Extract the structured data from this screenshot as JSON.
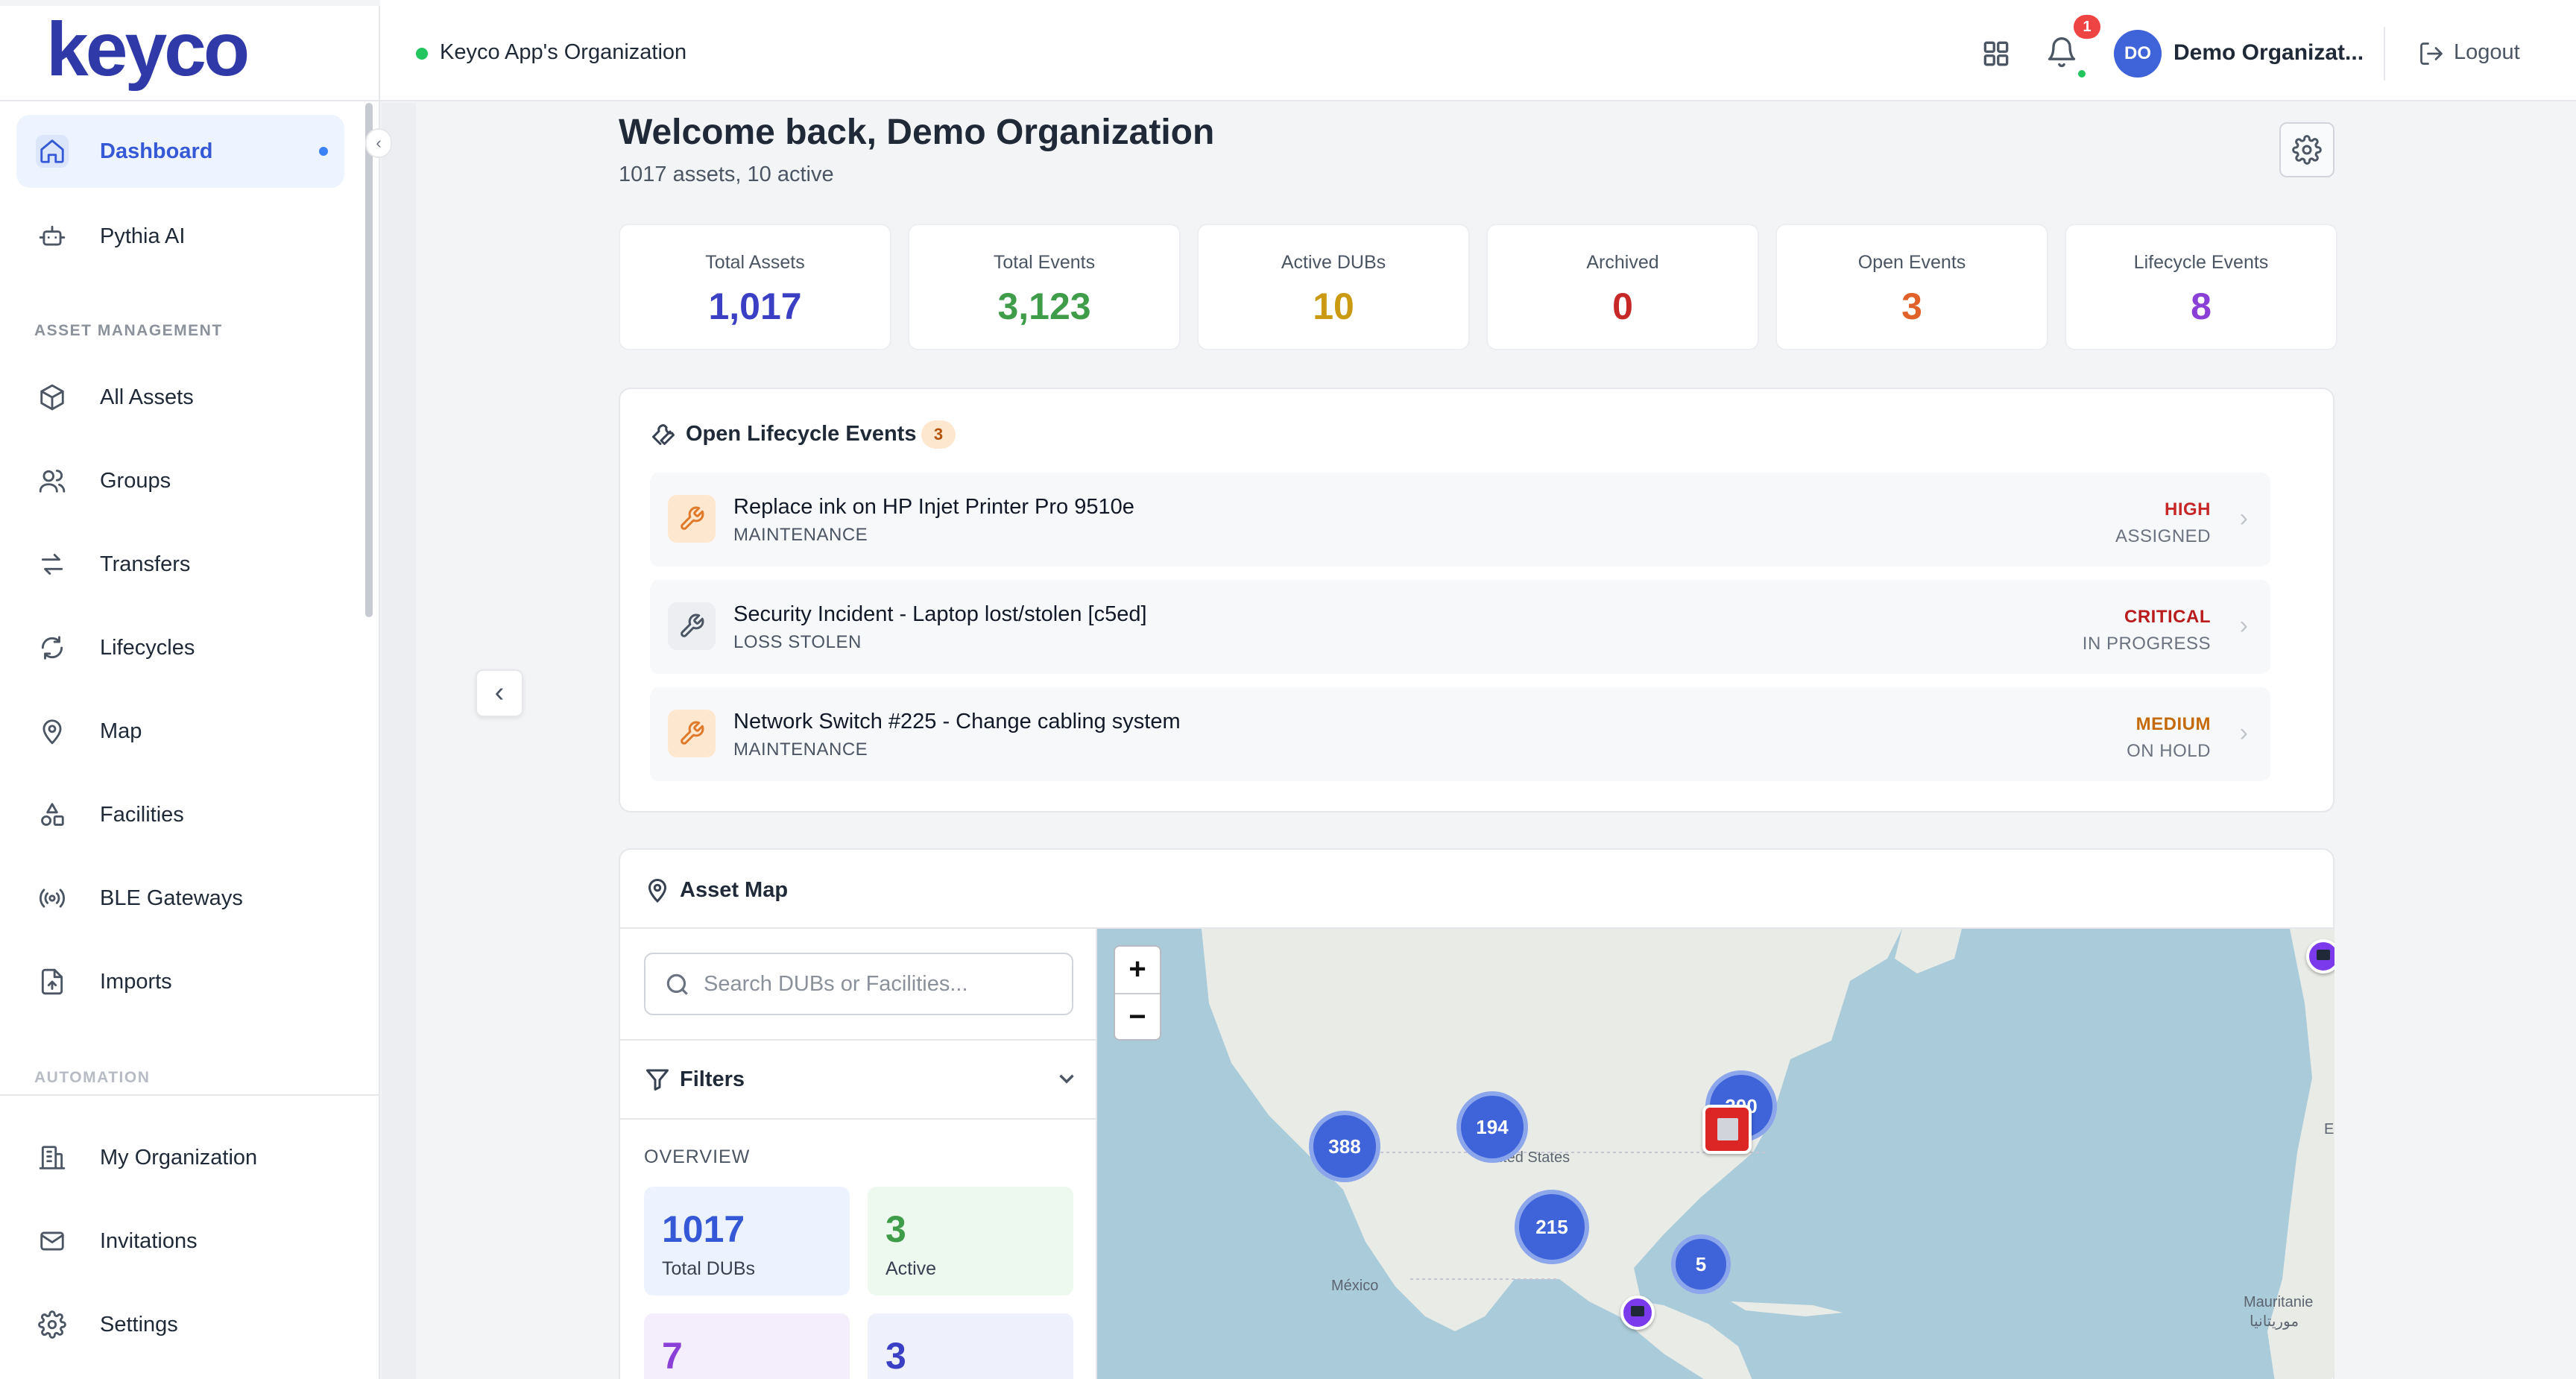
{
  "app": {
    "brand": "keyco"
  },
  "sidebar": {
    "top_items": [
      {
        "label": "Dashboard",
        "icon": "home-icon",
        "active": true
      },
      {
        "label": "Pythia AI",
        "icon": "robot-icon"
      }
    ],
    "sections": [
      {
        "label": "ASSET MANAGEMENT",
        "items": [
          {
            "label": "All Assets",
            "icon": "box-icon"
          },
          {
            "label": "Groups",
            "icon": "users-icon"
          },
          {
            "label": "Transfers",
            "icon": "transfer-icon"
          },
          {
            "label": "Lifecycles",
            "icon": "refresh-icon"
          },
          {
            "label": "Map",
            "icon": "map-pin-icon"
          },
          {
            "label": "Facilities",
            "icon": "shapes-icon"
          },
          {
            "label": "BLE Gateways",
            "icon": "broadcast-icon"
          },
          {
            "label": "Imports",
            "icon": "file-upload-icon"
          }
        ]
      },
      {
        "label": "AUTOMATION",
        "items": []
      }
    ],
    "bottom_items": [
      {
        "label": "My Organization",
        "icon": "building-icon"
      },
      {
        "label": "Invitations",
        "icon": "mail-icon"
      },
      {
        "label": "Settings",
        "icon": "gear-icon"
      }
    ]
  },
  "topbar": {
    "org_name": "Keyco App's Organization",
    "notification_count": "1",
    "avatar_initials": "DO",
    "user_name": "Demo Organizat...",
    "logout_label": "Logout"
  },
  "welcome": {
    "title": "Welcome back, Demo Organization",
    "subtitle": "1017 assets, 10 active"
  },
  "stats": [
    {
      "label": "Total Assets",
      "value": "1,017",
      "color": "#3b3fc4"
    },
    {
      "label": "Total Events",
      "value": "3,123",
      "color": "#3f9d4a"
    },
    {
      "label": "Active DUBs",
      "value": "10",
      "color": "#c99a12"
    },
    {
      "label": "Archived",
      "value": "0",
      "color": "#c62828"
    },
    {
      "label": "Open Events",
      "value": "3",
      "color": "#e0622a"
    },
    {
      "label": "Lifecycle Events",
      "value": "8",
      "color": "#8a3fd6"
    }
  ],
  "lifecycle_panel": {
    "title": "Open Lifecycle Events",
    "count": "3",
    "events": [
      {
        "title": "Replace ink on HP Injet Printer Pro 9510e",
        "type": "MAINTENANCE",
        "priority": "HIGH",
        "priority_color": "#c62828",
        "status": "ASSIGNED",
        "icon_bg": "#fde8cf",
        "icon_color": "#e07a2b"
      },
      {
        "title": "Security Incident - Laptop lost/stolen [c5ed]",
        "type": "LOSS STOLEN",
        "priority": "CRITICAL",
        "priority_color": "#b91c1c",
        "status": "IN PROGRESS",
        "icon_bg": "#eceef1",
        "icon_color": "#4b5563"
      },
      {
        "title": "Network Switch #225 - Change cabling system",
        "type": "MAINTENANCE",
        "priority": "MEDIUM",
        "priority_color": "#c46a0a",
        "status": "ON HOLD",
        "icon_bg": "#fde8cf",
        "icon_color": "#e07a2b"
      }
    ]
  },
  "map_panel": {
    "title": "Asset Map",
    "search_placeholder": "Search DUBs or Facilities...",
    "filters_label": "Filters",
    "overview_label": "OVERVIEW",
    "overview_cards": [
      {
        "value": "1017",
        "label": "Total DUBs",
        "color": "#3559d6",
        "bg": "#edf3fe"
      },
      {
        "value": "3",
        "label": "Active",
        "color": "#3f9d4a",
        "bg": "#edf8ef"
      },
      {
        "value": "7",
        "label": "",
        "color": "#8a3fd6",
        "bg": "#f4eefc"
      },
      {
        "value": "3",
        "label": "",
        "color": "#3b3fc4",
        "bg": "#eef0fc"
      }
    ],
    "clusters": [
      "388",
      "194",
      "215",
      "5",
      "200"
    ],
    "map_labels": [
      "United States",
      "México",
      "Mauritanie",
      "موريتانيا",
      "E",
      "Unit"
    ],
    "zoom_in": "+",
    "zoom_out": "−"
  }
}
